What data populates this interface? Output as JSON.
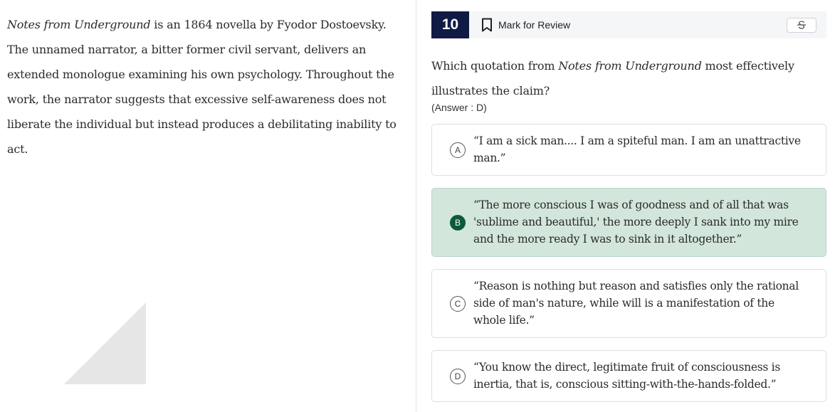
{
  "passage": {
    "title_italic": "Notes from Underground",
    "text": " is an 1864 novella by Fyodor Dostoevsky. The unnamed narrator, a bitter former civil servant, delivers an extended monologue examining his own psychology. Throughout the work, the narrator suggests that excessive self-awareness does not liberate the individual but instead produces a debilitating inability to act."
  },
  "header": {
    "question_number": "10",
    "mark_for_review_label": "Mark for Review",
    "icons": {
      "bookmark": "bookmark-icon",
      "strikethrough": "strikethrough-icon"
    }
  },
  "question": {
    "prefix": "Which quotation from ",
    "title_italic": "Notes from Underground",
    "suffix": " most effectively illustrates the claim?",
    "answer_note": "(Answer : D)"
  },
  "options": [
    {
      "letter": "A",
      "text": "“I am a sick man.... I am a spiteful man. I am an unattractive man.”",
      "selected": false
    },
    {
      "letter": "B",
      "text": "“The more conscious I was of goodness and of all that was 'sublime and beautiful,' the more deeply I sank into my mire and the more ready I was to sink in it altogether.”",
      "selected": true
    },
    {
      "letter": "C",
      "text": "“Reason is nothing but reason and satisfies only the rational side of man's nature, while will is a manifestation of the whole life.”",
      "selected": false
    },
    {
      "letter": "D",
      "text": "“You know the direct, legitimate fruit of consciousness is inertia, that is, conscious sitting-with-the-hands-folded.”",
      "selected": false
    }
  ],
  "colors": {
    "header_number_bg": "#0f1b44",
    "selected_option_bg": "#d2e6dc",
    "selected_letter_bg": "#0d5a3b"
  }
}
